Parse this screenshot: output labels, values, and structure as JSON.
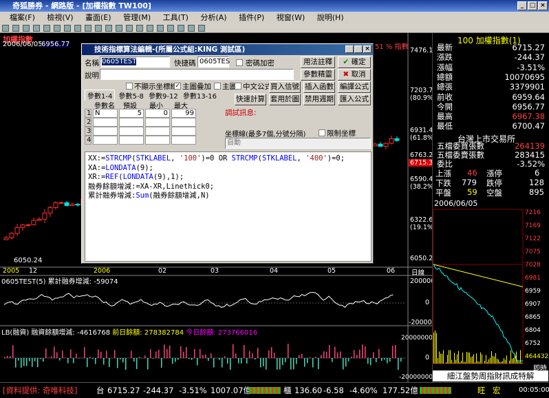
{
  "window": {
    "title": "奇狐勝券 - 網路版 - [加權指數 TW100]",
    "min": "_",
    "max": "□",
    "close": "×"
  },
  "menu": [
    "檔案(F)",
    "檢視(V)",
    "畫面(E)",
    "管理(M)",
    "工具(T)",
    "分析(A)",
    "插件(P)",
    "視窗(W)",
    "說明(H)"
  ],
  "chart": {
    "name": "加權指數",
    "date": "2006/06/05",
    "price_label": "6956.77",
    "right_title": "51 % 指數",
    "price_axis": [
      "7476.1",
      "7203.7",
      "(80.9%)",
      "6931.4",
      "(61.8%)",
      "6763.2",
      "6715.3",
      "6590.4",
      "(38.2%)",
      "6322.6",
      "(19.1%)",
      "6050.2"
    ],
    "low_label": "6050.24",
    "xaxis": [
      "2005",
      "12",
      "2006",
      "02",
      "03",
      "04",
      "05",
      "06",
      "日線"
    ],
    "ind1": {
      "title": "0605TEST(5) 累計融券增減: -59074",
      "ticks": [
        "200000",
        "0",
        "-200000"
      ]
    },
    "ind2": {
      "title": "LB(融資) 融資餘額增減: -4616768",
      "prev": "前日餘額: 278382784",
      "today": "今日餘額: 273766016",
      "ticks": [
        "200000000",
        "0",
        "-200000000"
      ]
    }
  },
  "quote": {
    "header": "100 加權指數(1)",
    "rows": [
      {
        "k": "最新",
        "v": "6715.27",
        "c": "#ffffff"
      },
      {
        "k": "漲跌",
        "v": "-244.37",
        "c": "#ffffff"
      },
      {
        "k": "漲幅",
        "v": "-3.51%",
        "c": "#ffffff"
      },
      {
        "k": "總額",
        "v": "10070695",
        "c": "#ffffff"
      },
      {
        "k": "總張",
        "v": "3379901",
        "c": "#ffffff"
      },
      {
        "k": "前收",
        "v": "6959.64",
        "c": "#ffffff"
      },
      {
        "k": "今開",
        "v": "6956.77",
        "c": "#ffffff"
      },
      {
        "k": "最高",
        "v": "6967.38",
        "c": "#ff4040"
      },
      {
        "k": "最低",
        "v": "6700.47",
        "c": "#ffffff"
      }
    ],
    "exchange": "台灣上市交易所",
    "rows2": [
      {
        "k": "五檔委買張數",
        "v": "264139",
        "c": "#ff4040"
      },
      {
        "k": "五檔委賣張數",
        "v": "283415",
        "c": "#ffffff"
      },
      {
        "k": "委比",
        "v": "-3.52%",
        "c": "#ffffff"
      }
    ],
    "up": "上漲",
    "up_v": "46",
    "lim_up": "漲停",
    "lim_up_v": "6",
    "down": "下跌",
    "down_v": "779",
    "lim_dn": "跌停",
    "lim_dn_v": "128",
    "flat": "平盤",
    "flat_v": "59",
    "none": "空盤",
    "none_v": "895",
    "intraday_date": "2006/06/05",
    "intraday_ticks": [
      "7216",
      "7169",
      "7122",
      "7075",
      "7028",
      "6981",
      "6959",
      "6907",
      "6865",
      "6804",
      "6752",
      "464432"
    ],
    "intraday_label": "即時",
    "ad": "細江盤勢周指財訊成特解"
  },
  "status": {
    "provider": "[資料提供: 奇唯科技]",
    "mkt1": "台",
    "v1": "6715.27",
    "d1": "-244.37",
    "p1": "-3.51%",
    "amt1": "1007.07億",
    "mkt2": "櫃",
    "v2": "136.60",
    "d2": "-6.58",
    "p2": "-4.60%",
    "amt2": "177.52億",
    "s1": "旺",
    "s2": "宏",
    "time": "00:05:00"
  },
  "dialog": {
    "title": "技術指標算法編輯-(所屬公式組:KING 測試區)",
    "name_label": "名稱",
    "name_val": "0605TEST",
    "hotkey_label": "快捷碼",
    "hotkey_val": "0605TES",
    "pwd_label": "密碼加密",
    "desc_label": "說明",
    "btn_usage": "用法註釋",
    "btn_ok": "確定",
    "btn_params": "參數精靈",
    "btn_cancel": "取消",
    "chk1": "不顯示坐標線",
    "chk2": "主圖疊加",
    "chk3": "主圖",
    "chk4": "中文公式",
    "btn_buy": "買入信號",
    "btn_insert": "插入函數",
    "btn_compile": "編譯公式",
    "btn_quick": "快速計算",
    "btn_apply": "套用於圖",
    "btn_disable": "禁用週期",
    "btn_import": "匯入公式",
    "tabs": [
      "參數1-4",
      "參數5-8",
      "參數9-12",
      "參數13-16"
    ],
    "param_headers": [
      "參數名",
      "預設",
      "最小",
      "最大"
    ],
    "params": [
      {
        "i": "1",
        "n": "N",
        "d": "5",
        "mn": "0",
        "mx": "99"
      },
      {
        "i": "2",
        "n": "",
        "d": "",
        "mn": "",
        "mx": ""
      },
      {
        "i": "3",
        "n": "",
        "d": "",
        "mn": "",
        "mx": ""
      },
      {
        "i": "4",
        "n": "",
        "d": "",
        "mn": "",
        "mx": ""
      }
    ],
    "debug_label": "調試訊息:",
    "axis_label": "坐標線(最多7個,分號分隔)",
    "limit_label": "限制坐標",
    "axis_val": "自動",
    "code": [
      "XX:=STRCMP(STKLABEL, '100')=0 OR STRCMP(STKLABEL, '400')=0;",
      "XA:=LONDATA(9);",
      "XR:=REF(LONDATA(9),1);",
      "融券餘額增減:=XA-XR,Linethick0;",
      "累計融券增減:Sum(融券餘額增減,N)"
    ]
  }
}
